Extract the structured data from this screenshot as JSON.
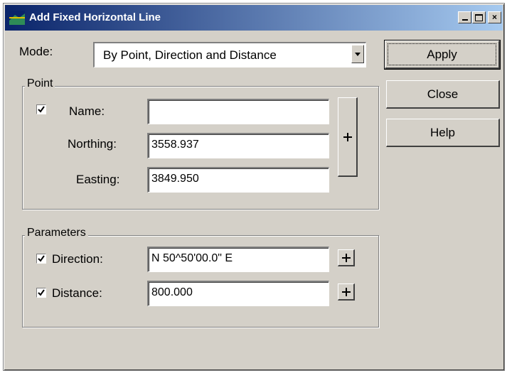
{
  "window": {
    "title": "Add Fixed Horizontal Line"
  },
  "mode": {
    "label": "Mode:",
    "value": "By Point, Direction and Distance"
  },
  "buttons": {
    "apply": "Apply",
    "close": "Close",
    "help": "Help"
  },
  "point": {
    "group_title": "Point",
    "name_label": "Name:",
    "name_value": "",
    "name_checked": true,
    "northing_label": "Northing:",
    "northing_value": "3558.937",
    "easting_label": "Easting:",
    "easting_value": "3849.950"
  },
  "parameters": {
    "group_title": "Parameters",
    "direction_label": "Direction:",
    "direction_value": "N 50^50'00.0\" E",
    "direction_checked": true,
    "distance_label": "Distance:",
    "distance_value": "800.000",
    "distance_checked": true
  },
  "icons": {
    "title": "app-icon",
    "pick": "locate-crosshair-icon",
    "check": "checkmark-icon"
  }
}
